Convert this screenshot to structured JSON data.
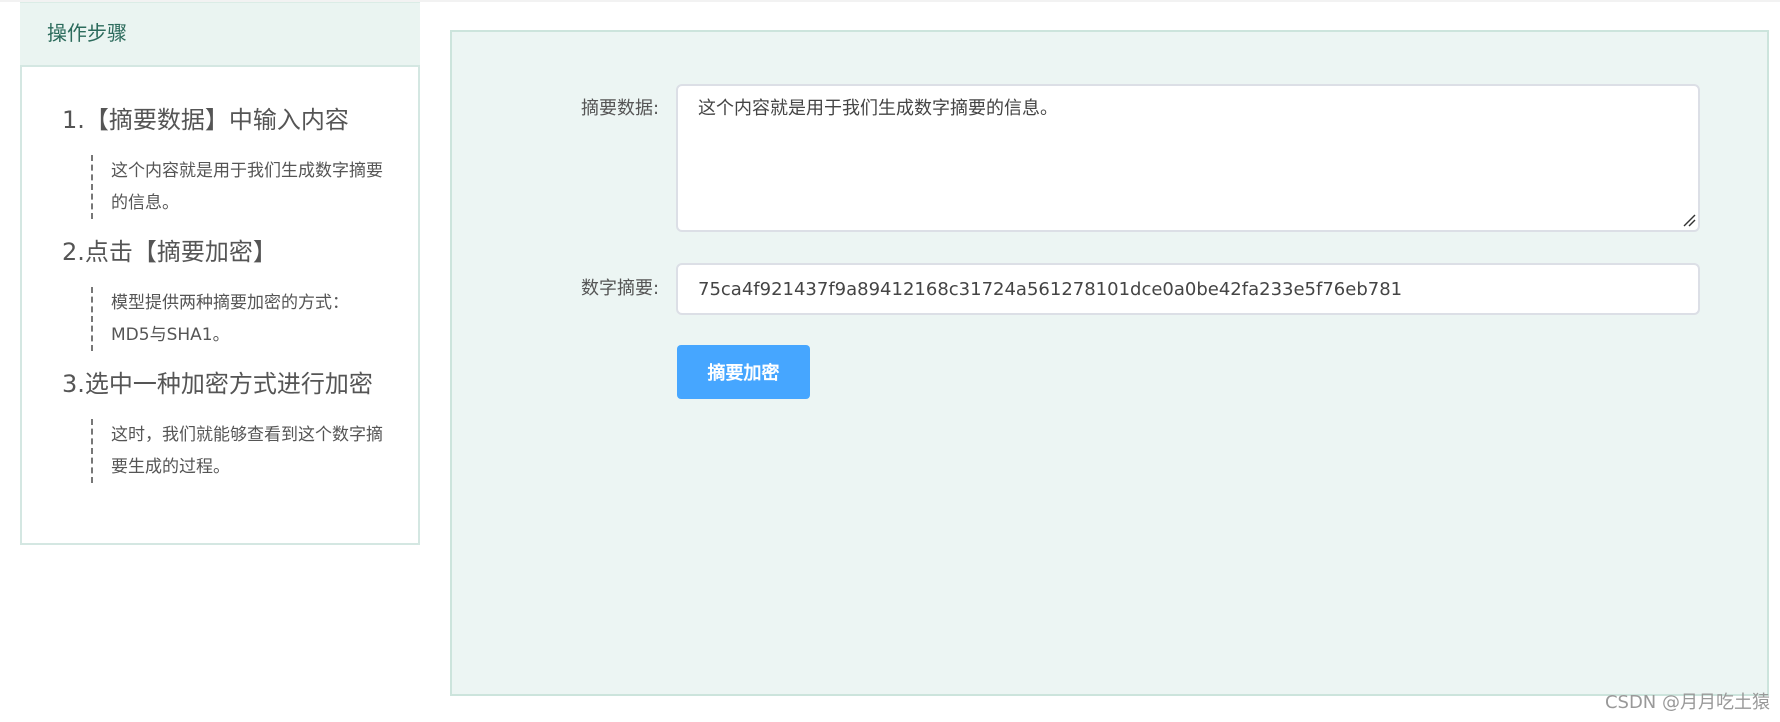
{
  "steps": {
    "header": "操作步骤",
    "items": [
      {
        "title": "1.【摘要数据】中输入内容",
        "desc": "这个内容就是用于我们生成数字摘要的信息。"
      },
      {
        "title": "2.点击【摘要加密】",
        "desc": "模型提供两种摘要加密的方式：MD5与SHA1。"
      },
      {
        "title": "3.选中一种加密方式进行加密",
        "desc": "这时，我们就能够查看到这个数字摘要生成的过程。"
      }
    ]
  },
  "form": {
    "data_label": "摘要数据:",
    "data_value": "这个内容就是用于我们生成数字摘要的信息。",
    "digest_label": "数字摘要:",
    "digest_value": "75ca4f921437f9a89412168c31724a561278101dce0a0be42fa233e5f76eb781",
    "encrypt_button": "摘要加密"
  },
  "watermark": "CSDN @月月吃土猿",
  "colors": {
    "accent": "#46a6ff",
    "panel_bg": "#ecf5f3",
    "header_bg": "#eaf4f1",
    "header_text": "#2c6b5c"
  }
}
